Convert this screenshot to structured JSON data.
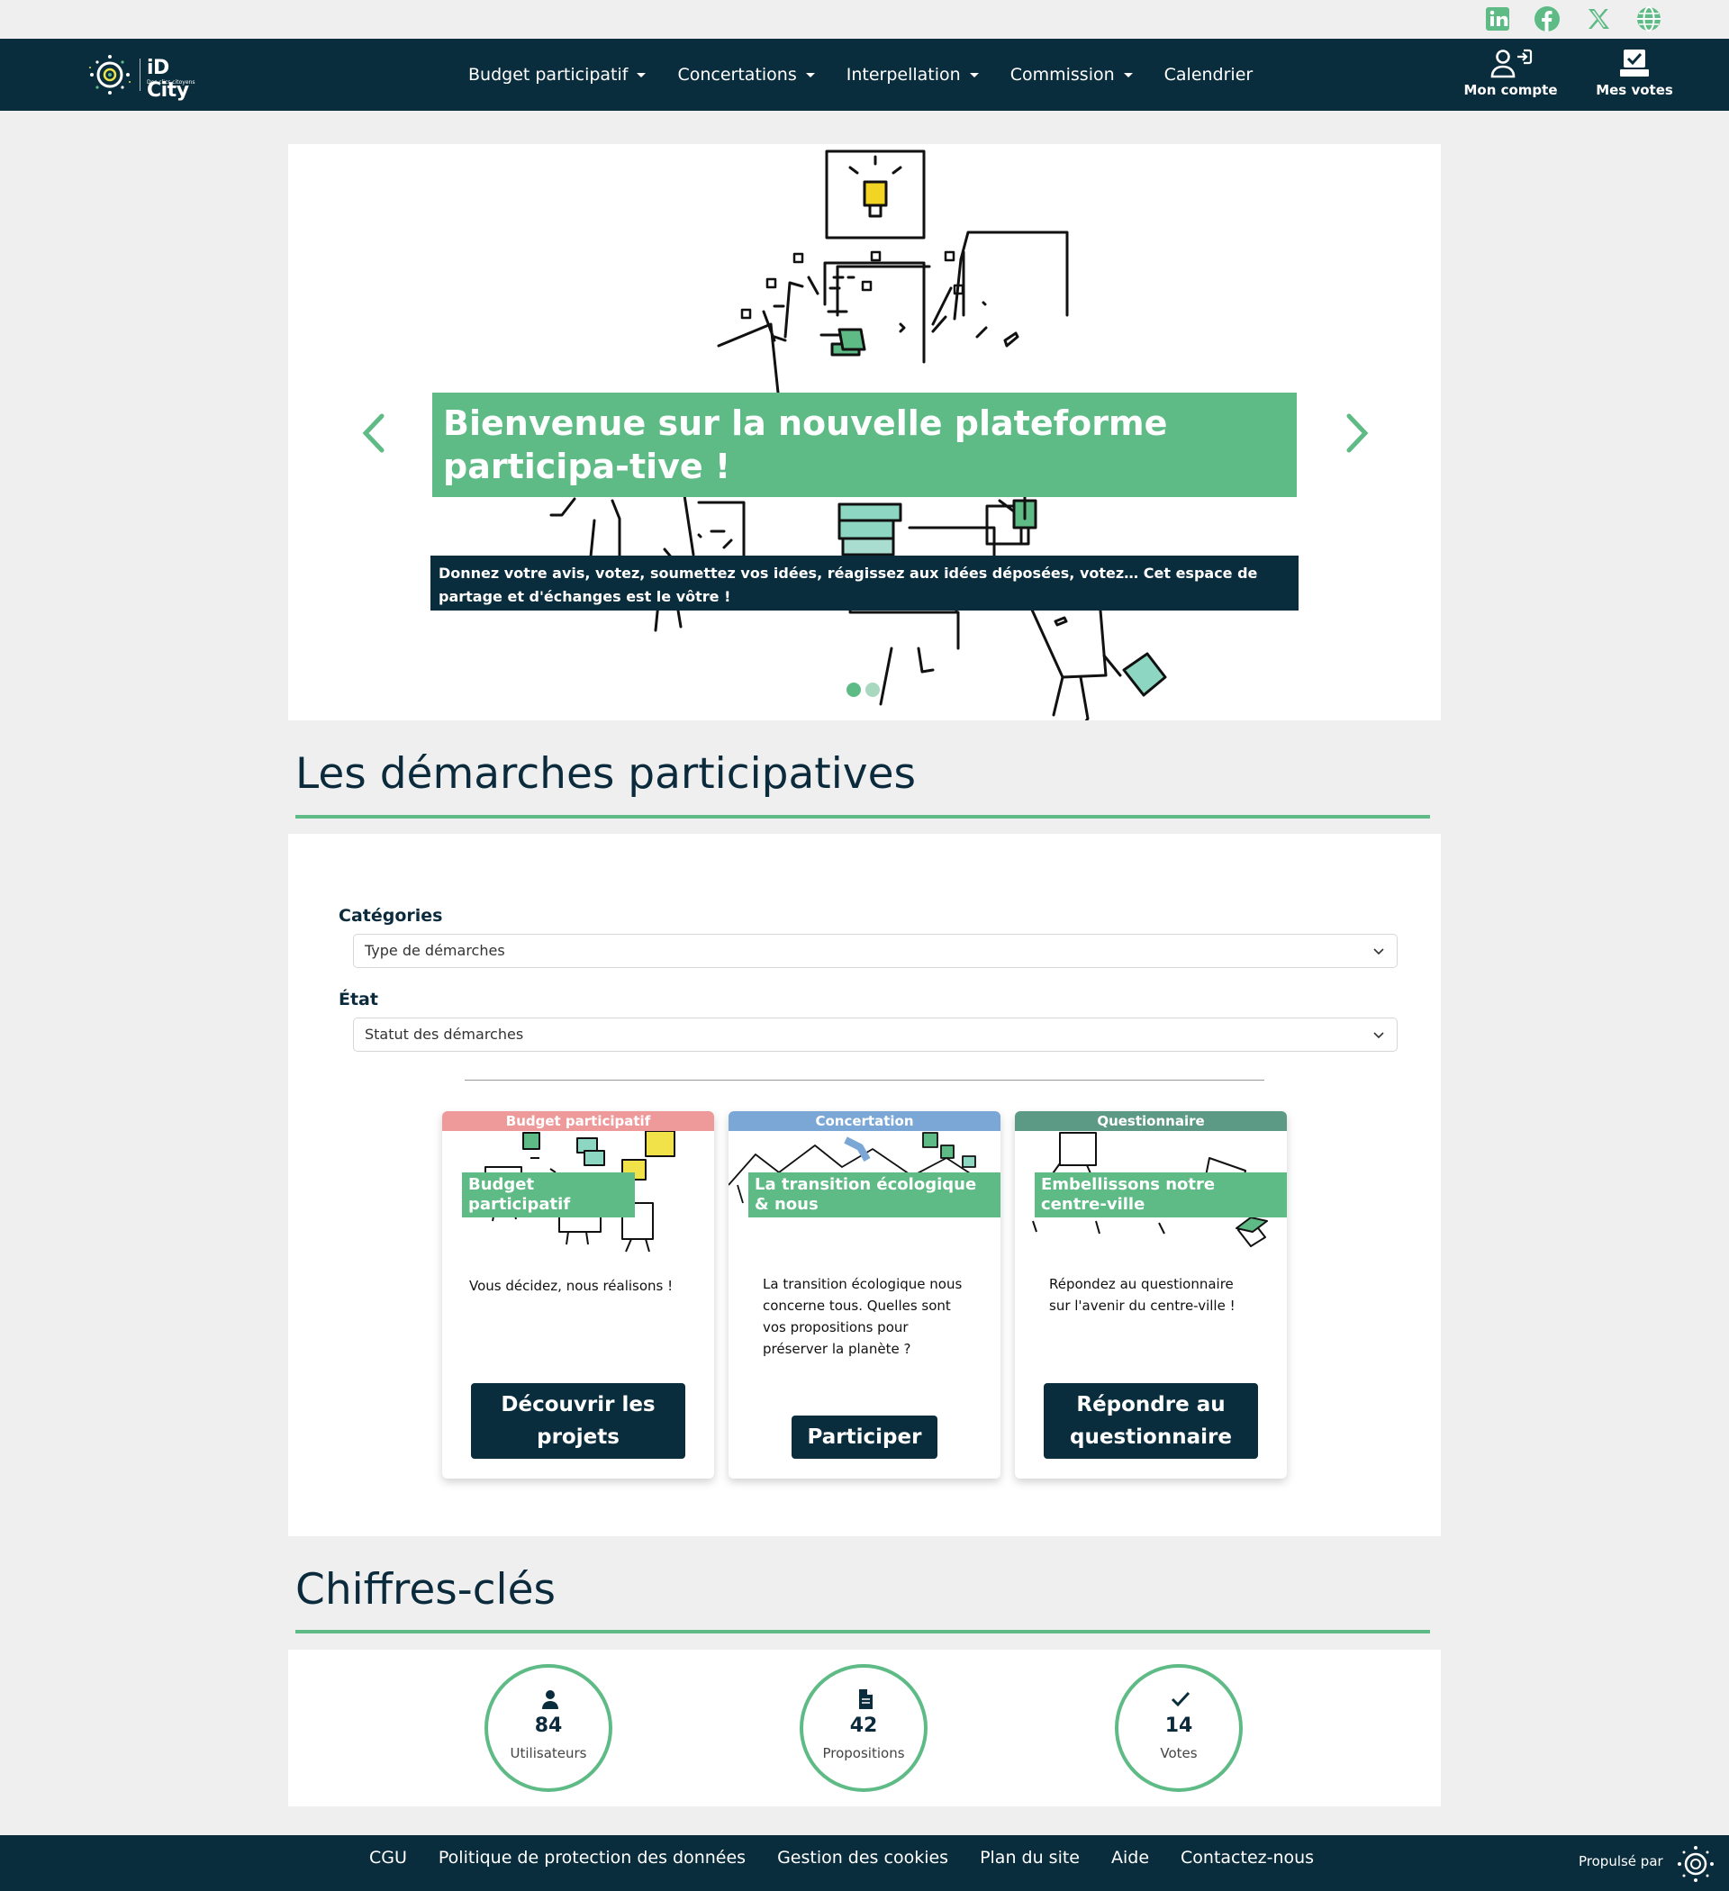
{
  "social": {
    "linkedin_icon": "linkedin-icon",
    "facebook_icon": "facebook-icon",
    "x_icon": "x-icon",
    "website_icon": "globe-icon",
    "color": "#5fbb86"
  },
  "header": {
    "logo_name": "iD City",
    "logo_tagline": "Des clics citoyens",
    "menu": [
      {
        "label": "Budget participatif"
      },
      {
        "label": "Concertations"
      },
      {
        "label": "Interpellation"
      },
      {
        "label": "Commission"
      },
      {
        "label": "Calendrier"
      }
    ],
    "account_label": "Mon compte",
    "votes_label": "Mes votes",
    "bg_color": "#0a2d3d"
  },
  "hero": {
    "title": "Bienvenue sur la nouvelle plateforme participa-tive !",
    "subtitle": "Donnez votre avis, votez, soumettez vos idées, réagissez aux idées déposées, votez… Cet espace de partage et d'échanges est le vôtre !",
    "slide_count": 2,
    "active_slide": 1,
    "accent_color": "#5fbb86"
  },
  "demarches": {
    "section_title": "Les démarches participatives",
    "filters": {
      "category_label": "Catégories",
      "category_value": "Type de démarches",
      "state_label": "État",
      "state_value": "Statut des démarches"
    },
    "cards": [
      {
        "tag": "Budget participatif",
        "tag_color": "#ef9a9a",
        "title": "Budget participatif",
        "description": "Vous décidez, nous réalisons !",
        "button": "Découvrir les projets"
      },
      {
        "tag": "Concertation",
        "tag_color": "#7ba7d6",
        "title": "La transition écologique & nous",
        "description": "La transition écologique nous concerne tous. Quelles sont vos propositions pour préserver la planète ?",
        "button": "Participer"
      },
      {
        "tag": "Questionnaire",
        "tag_color": "#5c9a85",
        "title": "Embellissons notre centre-ville",
        "description": "Répondez au questionnaire sur l'avenir du centre-ville !",
        "button": "Répondre au questionnaire"
      }
    ]
  },
  "stats": {
    "section_title": "Chiffres-clés",
    "items": [
      {
        "icon": "user-icon",
        "value": "84",
        "label": "Utilisateurs"
      },
      {
        "icon": "file-icon",
        "value": "42",
        "label": "Propositions"
      },
      {
        "icon": "check-icon",
        "value": "14",
        "label": "Votes"
      }
    ]
  },
  "footer": {
    "links": [
      {
        "label": "CGU"
      },
      {
        "label": "Politique de protection des données"
      },
      {
        "label": "Gestion des cookies"
      },
      {
        "label": "Plan du site"
      },
      {
        "label": "Aide"
      },
      {
        "label": "Contactez-nous"
      }
    ],
    "powered_by": "Propulsé par"
  }
}
